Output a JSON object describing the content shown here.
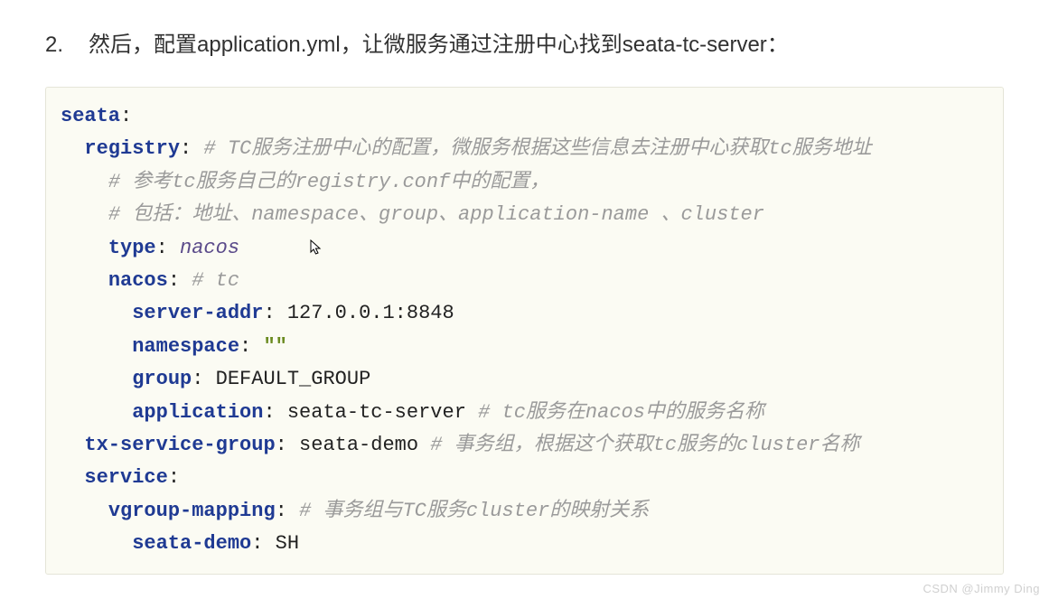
{
  "heading": {
    "num": "2.",
    "text": "然后，配置application.yml，让微服务通过注册中心找到seata-tc-server："
  },
  "yaml": {
    "l1_key": "seata",
    "l2_key": "registry",
    "l2_com": "# TC服务注册中心的配置，微服务根据这些信息去注册中心获取tc服务地址",
    "l3_com": "# 参考tc服务自己的registry.conf中的配置，",
    "l4_com": "# 包括：地址、namespace、group、application-name 、cluster",
    "l5_key": "type",
    "l5_val": "nacos",
    "l6_key": "nacos",
    "l6_com": "# tc",
    "l7_key": "server-addr",
    "l7_val": "127.0.0.1:8848",
    "l8_key": "namespace",
    "l8_val": "\"\"",
    "l9_key": "group",
    "l9_val": "DEFAULT_GROUP",
    "l10_key": "application",
    "l10_val": "seata-tc-server",
    "l10_com": "# tc服务在nacos中的服务名称",
    "l11_key": "tx-service-group",
    "l11_val": "seata-demo",
    "l11_com": "# 事务组，根据这个获取tc服务的cluster名称",
    "l12_key": "service",
    "l13_key": "vgroup-mapping",
    "l13_com": "# 事务组与TC服务cluster的映射关系",
    "l14_key": "seata-demo",
    "l14_val": "SH"
  },
  "watermark": "CSDN @Jimmy Ding"
}
